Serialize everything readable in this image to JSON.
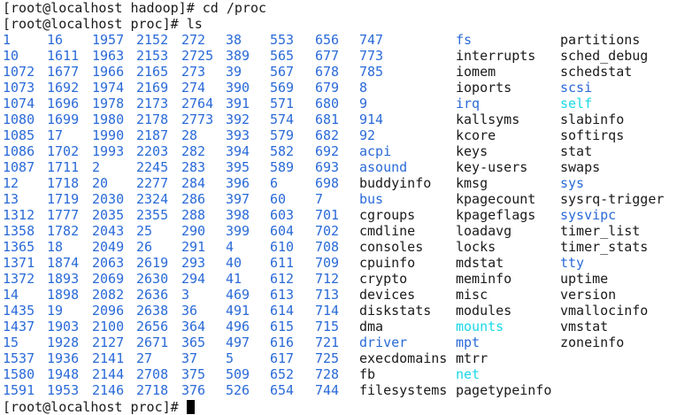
{
  "colors": {
    "background": "#ffffff",
    "default": "#1a1a1a",
    "directory": "#2a6ad8",
    "symlink": "#1ad8e6",
    "cursor": "#000000"
  },
  "prompt_lines": [
    "[root@localhost hadoop]# cd /proc",
    "[root@localhost proc]# ls"
  ],
  "final_prompt": "[root@localhost proc]# ",
  "ls_columns": [
    [
      {
        "name": "1",
        "type": "dir"
      },
      {
        "name": "10",
        "type": "dir"
      },
      {
        "name": "1072",
        "type": "dir"
      },
      {
        "name": "1073",
        "type": "dir"
      },
      {
        "name": "1074",
        "type": "dir"
      },
      {
        "name": "1080",
        "type": "dir"
      },
      {
        "name": "1085",
        "type": "dir"
      },
      {
        "name": "1086",
        "type": "dir"
      },
      {
        "name": "1087",
        "type": "dir"
      },
      {
        "name": "12",
        "type": "dir"
      },
      {
        "name": "13",
        "type": "dir"
      },
      {
        "name": "1312",
        "type": "dir"
      },
      {
        "name": "1358",
        "type": "dir"
      },
      {
        "name": "1365",
        "type": "dir"
      },
      {
        "name": "1371",
        "type": "dir"
      },
      {
        "name": "1372",
        "type": "dir"
      },
      {
        "name": "14",
        "type": "dir"
      },
      {
        "name": "1435",
        "type": "dir"
      },
      {
        "name": "1437",
        "type": "dir"
      },
      {
        "name": "15",
        "type": "dir"
      },
      {
        "name": "1537",
        "type": "dir"
      },
      {
        "name": "1580",
        "type": "dir"
      },
      {
        "name": "1591",
        "type": "dir"
      }
    ],
    [
      {
        "name": "16",
        "type": "dir"
      },
      {
        "name": "1611",
        "type": "dir"
      },
      {
        "name": "1677",
        "type": "dir"
      },
      {
        "name": "1692",
        "type": "dir"
      },
      {
        "name": "1696",
        "type": "dir"
      },
      {
        "name": "1699",
        "type": "dir"
      },
      {
        "name": "17",
        "type": "dir"
      },
      {
        "name": "1702",
        "type": "dir"
      },
      {
        "name": "1711",
        "type": "dir"
      },
      {
        "name": "1718",
        "type": "dir"
      },
      {
        "name": "1719",
        "type": "dir"
      },
      {
        "name": "1777",
        "type": "dir"
      },
      {
        "name": "1782",
        "type": "dir"
      },
      {
        "name": "18",
        "type": "dir"
      },
      {
        "name": "1874",
        "type": "dir"
      },
      {
        "name": "1893",
        "type": "dir"
      },
      {
        "name": "1898",
        "type": "dir"
      },
      {
        "name": "19",
        "type": "dir"
      },
      {
        "name": "1903",
        "type": "dir"
      },
      {
        "name": "1928",
        "type": "dir"
      },
      {
        "name": "1936",
        "type": "dir"
      },
      {
        "name": "1948",
        "type": "dir"
      },
      {
        "name": "1953",
        "type": "dir"
      }
    ],
    [
      {
        "name": "1957",
        "type": "dir"
      },
      {
        "name": "1963",
        "type": "dir"
      },
      {
        "name": "1966",
        "type": "dir"
      },
      {
        "name": "1974",
        "type": "dir"
      },
      {
        "name": "1978",
        "type": "dir"
      },
      {
        "name": "1980",
        "type": "dir"
      },
      {
        "name": "1990",
        "type": "dir"
      },
      {
        "name": "1993",
        "type": "dir"
      },
      {
        "name": "2",
        "type": "dir"
      },
      {
        "name": "20",
        "type": "dir"
      },
      {
        "name": "2030",
        "type": "dir"
      },
      {
        "name": "2035",
        "type": "dir"
      },
      {
        "name": "2043",
        "type": "dir"
      },
      {
        "name": "2049",
        "type": "dir"
      },
      {
        "name": "2063",
        "type": "dir"
      },
      {
        "name": "2069",
        "type": "dir"
      },
      {
        "name": "2082",
        "type": "dir"
      },
      {
        "name": "2096",
        "type": "dir"
      },
      {
        "name": "2100",
        "type": "dir"
      },
      {
        "name": "2127",
        "type": "dir"
      },
      {
        "name": "2141",
        "type": "dir"
      },
      {
        "name": "2144",
        "type": "dir"
      },
      {
        "name": "2146",
        "type": "dir"
      }
    ],
    [
      {
        "name": "2152",
        "type": "dir"
      },
      {
        "name": "2153",
        "type": "dir"
      },
      {
        "name": "2165",
        "type": "dir"
      },
      {
        "name": "2169",
        "type": "dir"
      },
      {
        "name": "2173",
        "type": "dir"
      },
      {
        "name": "2178",
        "type": "dir"
      },
      {
        "name": "2187",
        "type": "dir"
      },
      {
        "name": "2203",
        "type": "dir"
      },
      {
        "name": "2245",
        "type": "dir"
      },
      {
        "name": "2277",
        "type": "dir"
      },
      {
        "name": "2324",
        "type": "dir"
      },
      {
        "name": "2355",
        "type": "dir"
      },
      {
        "name": "25",
        "type": "dir"
      },
      {
        "name": "26",
        "type": "dir"
      },
      {
        "name": "2619",
        "type": "dir"
      },
      {
        "name": "2630",
        "type": "dir"
      },
      {
        "name": "2636",
        "type": "dir"
      },
      {
        "name": "2638",
        "type": "dir"
      },
      {
        "name": "2656",
        "type": "dir"
      },
      {
        "name": "2671",
        "type": "dir"
      },
      {
        "name": "27",
        "type": "dir"
      },
      {
        "name": "2708",
        "type": "dir"
      },
      {
        "name": "2718",
        "type": "dir"
      }
    ],
    [
      {
        "name": "272",
        "type": "dir"
      },
      {
        "name": "2725",
        "type": "dir"
      },
      {
        "name": "273",
        "type": "dir"
      },
      {
        "name": "274",
        "type": "dir"
      },
      {
        "name": "2764",
        "type": "dir"
      },
      {
        "name": "2773",
        "type": "dir"
      },
      {
        "name": "28",
        "type": "dir"
      },
      {
        "name": "282",
        "type": "dir"
      },
      {
        "name": "283",
        "type": "dir"
      },
      {
        "name": "284",
        "type": "dir"
      },
      {
        "name": "286",
        "type": "dir"
      },
      {
        "name": "288",
        "type": "dir"
      },
      {
        "name": "290",
        "type": "dir"
      },
      {
        "name": "291",
        "type": "dir"
      },
      {
        "name": "293",
        "type": "dir"
      },
      {
        "name": "294",
        "type": "dir"
      },
      {
        "name": "3",
        "type": "dir"
      },
      {
        "name": "36",
        "type": "dir"
      },
      {
        "name": "364",
        "type": "dir"
      },
      {
        "name": "365",
        "type": "dir"
      },
      {
        "name": "37",
        "type": "dir"
      },
      {
        "name": "375",
        "type": "dir"
      },
      {
        "name": "376",
        "type": "dir"
      }
    ],
    [
      {
        "name": "38",
        "type": "dir"
      },
      {
        "name": "389",
        "type": "dir"
      },
      {
        "name": "39",
        "type": "dir"
      },
      {
        "name": "390",
        "type": "dir"
      },
      {
        "name": "391",
        "type": "dir"
      },
      {
        "name": "392",
        "type": "dir"
      },
      {
        "name": "393",
        "type": "dir"
      },
      {
        "name": "394",
        "type": "dir"
      },
      {
        "name": "395",
        "type": "dir"
      },
      {
        "name": "396",
        "type": "dir"
      },
      {
        "name": "397",
        "type": "dir"
      },
      {
        "name": "398",
        "type": "dir"
      },
      {
        "name": "399",
        "type": "dir"
      },
      {
        "name": "4",
        "type": "dir"
      },
      {
        "name": "40",
        "type": "dir"
      },
      {
        "name": "41",
        "type": "dir"
      },
      {
        "name": "469",
        "type": "dir"
      },
      {
        "name": "491",
        "type": "dir"
      },
      {
        "name": "496",
        "type": "dir"
      },
      {
        "name": "497",
        "type": "dir"
      },
      {
        "name": "5",
        "type": "dir"
      },
      {
        "name": "509",
        "type": "dir"
      },
      {
        "name": "526",
        "type": "dir"
      }
    ],
    [
      {
        "name": "553",
        "type": "dir"
      },
      {
        "name": "565",
        "type": "dir"
      },
      {
        "name": "567",
        "type": "dir"
      },
      {
        "name": "569",
        "type": "dir"
      },
      {
        "name": "571",
        "type": "dir"
      },
      {
        "name": "574",
        "type": "dir"
      },
      {
        "name": "579",
        "type": "dir"
      },
      {
        "name": "582",
        "type": "dir"
      },
      {
        "name": "589",
        "type": "dir"
      },
      {
        "name": "6",
        "type": "dir"
      },
      {
        "name": "60",
        "type": "dir"
      },
      {
        "name": "603",
        "type": "dir"
      },
      {
        "name": "604",
        "type": "dir"
      },
      {
        "name": "610",
        "type": "dir"
      },
      {
        "name": "611",
        "type": "dir"
      },
      {
        "name": "612",
        "type": "dir"
      },
      {
        "name": "613",
        "type": "dir"
      },
      {
        "name": "614",
        "type": "dir"
      },
      {
        "name": "615",
        "type": "dir"
      },
      {
        "name": "616",
        "type": "dir"
      },
      {
        "name": "617",
        "type": "dir"
      },
      {
        "name": "652",
        "type": "dir"
      },
      {
        "name": "654",
        "type": "dir"
      }
    ],
    [
      {
        "name": "656",
        "type": "dir"
      },
      {
        "name": "677",
        "type": "dir"
      },
      {
        "name": "678",
        "type": "dir"
      },
      {
        "name": "679",
        "type": "dir"
      },
      {
        "name": "680",
        "type": "dir"
      },
      {
        "name": "681",
        "type": "dir"
      },
      {
        "name": "682",
        "type": "dir"
      },
      {
        "name": "692",
        "type": "dir"
      },
      {
        "name": "693",
        "type": "dir"
      },
      {
        "name": "698",
        "type": "dir"
      },
      {
        "name": "7",
        "type": "dir"
      },
      {
        "name": "701",
        "type": "dir"
      },
      {
        "name": "702",
        "type": "dir"
      },
      {
        "name": "708",
        "type": "dir"
      },
      {
        "name": "709",
        "type": "dir"
      },
      {
        "name": "712",
        "type": "dir"
      },
      {
        "name": "713",
        "type": "dir"
      },
      {
        "name": "714",
        "type": "dir"
      },
      {
        "name": "715",
        "type": "dir"
      },
      {
        "name": "721",
        "type": "dir"
      },
      {
        "name": "725",
        "type": "dir"
      },
      {
        "name": "728",
        "type": "dir"
      },
      {
        "name": "744",
        "type": "dir"
      }
    ],
    [
      {
        "name": "747",
        "type": "dir"
      },
      {
        "name": "773",
        "type": "dir"
      },
      {
        "name": "785",
        "type": "dir"
      },
      {
        "name": "8",
        "type": "dir"
      },
      {
        "name": "9",
        "type": "dir"
      },
      {
        "name": "914",
        "type": "dir"
      },
      {
        "name": "92",
        "type": "dir"
      },
      {
        "name": "acpi",
        "type": "dir"
      },
      {
        "name": "asound",
        "type": "dir"
      },
      {
        "name": "buddyinfo",
        "type": "file"
      },
      {
        "name": "bus",
        "type": "dir"
      },
      {
        "name": "cgroups",
        "type": "file"
      },
      {
        "name": "cmdline",
        "type": "file"
      },
      {
        "name": "consoles",
        "type": "file"
      },
      {
        "name": "cpuinfo",
        "type": "file"
      },
      {
        "name": "crypto",
        "type": "file"
      },
      {
        "name": "devices",
        "type": "file"
      },
      {
        "name": "diskstats",
        "type": "file"
      },
      {
        "name": "dma",
        "type": "file"
      },
      {
        "name": "driver",
        "type": "dir"
      },
      {
        "name": "execdomains",
        "type": "file"
      },
      {
        "name": "fb",
        "type": "file"
      },
      {
        "name": "filesystems",
        "type": "file"
      }
    ],
    [
      {
        "name": "fs",
        "type": "dir"
      },
      {
        "name": "interrupts",
        "type": "file"
      },
      {
        "name": "iomem",
        "type": "file"
      },
      {
        "name": "ioports",
        "type": "file"
      },
      {
        "name": "irq",
        "type": "dir"
      },
      {
        "name": "kallsyms",
        "type": "file"
      },
      {
        "name": "kcore",
        "type": "file"
      },
      {
        "name": "keys",
        "type": "file"
      },
      {
        "name": "key-users",
        "type": "file"
      },
      {
        "name": "kmsg",
        "type": "file"
      },
      {
        "name": "kpagecount",
        "type": "file"
      },
      {
        "name": "kpageflags",
        "type": "file"
      },
      {
        "name": "loadavg",
        "type": "file"
      },
      {
        "name": "locks",
        "type": "file"
      },
      {
        "name": "mdstat",
        "type": "file"
      },
      {
        "name": "meminfo",
        "type": "file"
      },
      {
        "name": "misc",
        "type": "file"
      },
      {
        "name": "modules",
        "type": "file"
      },
      {
        "name": "mounts",
        "type": "link"
      },
      {
        "name": "mpt",
        "type": "dir"
      },
      {
        "name": "mtrr",
        "type": "file"
      },
      {
        "name": "net",
        "type": "link"
      },
      {
        "name": "pagetypeinfo",
        "type": "file"
      }
    ],
    [
      {
        "name": "partitions",
        "type": "file"
      },
      {
        "name": "sched_debug",
        "type": "file"
      },
      {
        "name": "schedstat",
        "type": "file"
      },
      {
        "name": "scsi",
        "type": "dir"
      },
      {
        "name": "self",
        "type": "link"
      },
      {
        "name": "slabinfo",
        "type": "file"
      },
      {
        "name": "softirqs",
        "type": "file"
      },
      {
        "name": "stat",
        "type": "file"
      },
      {
        "name": "swaps",
        "type": "file"
      },
      {
        "name": "sys",
        "type": "dir"
      },
      {
        "name": "sysrq-trigger",
        "type": "file"
      },
      {
        "name": "sysvipc",
        "type": "dir"
      },
      {
        "name": "timer_list",
        "type": "file"
      },
      {
        "name": "timer_stats",
        "type": "file"
      },
      {
        "name": "tty",
        "type": "dir"
      },
      {
        "name": "uptime",
        "type": "file"
      },
      {
        "name": "version",
        "type": "file"
      },
      {
        "name": "vmallocinfo",
        "type": "file"
      },
      {
        "name": "vmstat",
        "type": "file"
      },
      {
        "name": "zoneinfo",
        "type": "file"
      }
    ]
  ]
}
